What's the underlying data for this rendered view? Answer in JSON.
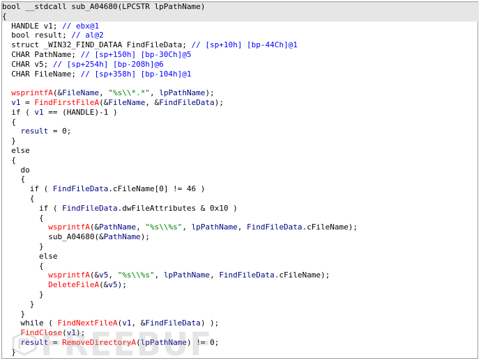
{
  "colors": {
    "keyword": "#000000",
    "comment": "#0000ff",
    "function": "#ff0000",
    "variable": "#000080",
    "string": "#008000",
    "highlight": "#e6e6e6"
  },
  "watermark": {
    "text": "FREEBUF"
  },
  "lines": [
    {
      "hl": true,
      "tokens": [
        {
          "c": "tx",
          "t": "bool __stdcall sub_A04680(LPCSTR lpPathName)"
        }
      ]
    },
    {
      "hl": true,
      "tokens": [
        {
          "c": "tx",
          "t": "{"
        }
      ]
    },
    {
      "tokens": [
        {
          "c": "tx",
          "t": "  HANDLE v1; "
        },
        {
          "c": "cm",
          "t": "// ebx@1"
        }
      ]
    },
    {
      "tokens": [
        {
          "c": "tx",
          "t": "  bool result; "
        },
        {
          "c": "cm",
          "t": "// al@2"
        }
      ]
    },
    {
      "tokens": [
        {
          "c": "tx",
          "t": "  struct _WIN32_FIND_DATAA FindFileData; "
        },
        {
          "c": "cm",
          "t": "// [sp+10h] [bp-44Ch]@1"
        }
      ]
    },
    {
      "tokens": [
        {
          "c": "tx",
          "t": "  CHAR PathName; "
        },
        {
          "c": "cm",
          "t": "// [sp+150h] [bp-30Ch]@5"
        }
      ]
    },
    {
      "tokens": [
        {
          "c": "tx",
          "t": "  CHAR v5; "
        },
        {
          "c": "cm",
          "t": "// [sp+254h] [bp-208h]@6"
        }
      ]
    },
    {
      "tokens": [
        {
          "c": "tx",
          "t": "  CHAR FileName; "
        },
        {
          "c": "cm",
          "t": "// [sp+358h] [bp-104h]@1"
        }
      ]
    },
    {
      "tokens": [
        {
          "c": "tx",
          "t": ""
        }
      ]
    },
    {
      "tokens": [
        {
          "c": "tx",
          "t": "  "
        },
        {
          "c": "fn",
          "t": "wsprintfA"
        },
        {
          "c": "tx",
          "t": "(&"
        },
        {
          "c": "va",
          "t": "FileName"
        },
        {
          "c": "tx",
          "t": ", "
        },
        {
          "c": "st",
          "t": "\"%s\\\\*.*\""
        },
        {
          "c": "tx",
          "t": ", "
        },
        {
          "c": "va",
          "t": "lpPathName"
        },
        {
          "c": "tx",
          "t": ");"
        }
      ]
    },
    {
      "tokens": [
        {
          "c": "tx",
          "t": "  "
        },
        {
          "c": "va",
          "t": "v1"
        },
        {
          "c": "tx",
          "t": " = "
        },
        {
          "c": "fn",
          "t": "FindFirstFileA"
        },
        {
          "c": "tx",
          "t": "(&"
        },
        {
          "c": "va",
          "t": "FileName"
        },
        {
          "c": "tx",
          "t": ", &"
        },
        {
          "c": "va",
          "t": "FindFileData"
        },
        {
          "c": "tx",
          "t": ");"
        }
      ]
    },
    {
      "tokens": [
        {
          "c": "tx",
          "t": "  if ( "
        },
        {
          "c": "va",
          "t": "v1"
        },
        {
          "c": "tx",
          "t": " == (HANDLE)-1 )"
        }
      ]
    },
    {
      "tokens": [
        {
          "c": "tx",
          "t": "  {"
        }
      ]
    },
    {
      "tokens": [
        {
          "c": "tx",
          "t": "    "
        },
        {
          "c": "va",
          "t": "result"
        },
        {
          "c": "tx",
          "t": " = 0;"
        }
      ]
    },
    {
      "tokens": [
        {
          "c": "tx",
          "t": "  }"
        }
      ]
    },
    {
      "tokens": [
        {
          "c": "tx",
          "t": "  else"
        }
      ]
    },
    {
      "tokens": [
        {
          "c": "tx",
          "t": "  {"
        }
      ]
    },
    {
      "tokens": [
        {
          "c": "tx",
          "t": "    do"
        }
      ]
    },
    {
      "tokens": [
        {
          "c": "tx",
          "t": "    {"
        }
      ]
    },
    {
      "tokens": [
        {
          "c": "tx",
          "t": "      if ( "
        },
        {
          "c": "va",
          "t": "FindFileData"
        },
        {
          "c": "tx",
          "t": ".cFileName[0] != 46 )"
        }
      ]
    },
    {
      "tokens": [
        {
          "c": "tx",
          "t": "      {"
        }
      ]
    },
    {
      "tokens": [
        {
          "c": "tx",
          "t": "        if ( "
        },
        {
          "c": "va",
          "t": "FindFileData"
        },
        {
          "c": "tx",
          "t": ".dwFileAttributes & 0x10 )"
        }
      ]
    },
    {
      "tokens": [
        {
          "c": "tx",
          "t": "        {"
        }
      ]
    },
    {
      "tokens": [
        {
          "c": "tx",
          "t": "          "
        },
        {
          "c": "fn",
          "t": "wsprintfA"
        },
        {
          "c": "tx",
          "t": "(&"
        },
        {
          "c": "va",
          "t": "PathName"
        },
        {
          "c": "tx",
          "t": ", "
        },
        {
          "c": "st",
          "t": "\"%s\\\\%s\""
        },
        {
          "c": "tx",
          "t": ", "
        },
        {
          "c": "va",
          "t": "lpPathName"
        },
        {
          "c": "tx",
          "t": ", "
        },
        {
          "c": "va",
          "t": "FindFileData"
        },
        {
          "c": "tx",
          "t": ".cFileName);"
        }
      ]
    },
    {
      "tokens": [
        {
          "c": "tx",
          "t": "          sub_A04680(&"
        },
        {
          "c": "va",
          "t": "PathName"
        },
        {
          "c": "tx",
          "t": ");"
        }
      ]
    },
    {
      "tokens": [
        {
          "c": "tx",
          "t": "        }"
        }
      ]
    },
    {
      "tokens": [
        {
          "c": "tx",
          "t": "        else"
        }
      ]
    },
    {
      "tokens": [
        {
          "c": "tx",
          "t": "        {"
        }
      ]
    },
    {
      "tokens": [
        {
          "c": "tx",
          "t": "          "
        },
        {
          "c": "fn",
          "t": "wsprintfA"
        },
        {
          "c": "tx",
          "t": "(&"
        },
        {
          "c": "va",
          "t": "v5"
        },
        {
          "c": "tx",
          "t": ", "
        },
        {
          "c": "st",
          "t": "\"%s\\\\%s\""
        },
        {
          "c": "tx",
          "t": ", "
        },
        {
          "c": "va",
          "t": "lpPathName"
        },
        {
          "c": "tx",
          "t": ", "
        },
        {
          "c": "va",
          "t": "FindFileData"
        },
        {
          "c": "tx",
          "t": ".cFileName);"
        }
      ]
    },
    {
      "tokens": [
        {
          "c": "tx",
          "t": "          "
        },
        {
          "c": "fn",
          "t": "DeleteFileA"
        },
        {
          "c": "tx",
          "t": "(&"
        },
        {
          "c": "va",
          "t": "v5"
        },
        {
          "c": "tx",
          "t": ");"
        }
      ]
    },
    {
      "tokens": [
        {
          "c": "tx",
          "t": "        }"
        }
      ]
    },
    {
      "tokens": [
        {
          "c": "tx",
          "t": "      }"
        }
      ]
    },
    {
      "tokens": [
        {
          "c": "tx",
          "t": "    }"
        }
      ]
    },
    {
      "tokens": [
        {
          "c": "tx",
          "t": "    while ( "
        },
        {
          "c": "fn",
          "t": "FindNextFileA"
        },
        {
          "c": "tx",
          "t": "("
        },
        {
          "c": "va",
          "t": "v1"
        },
        {
          "c": "tx",
          "t": ", &"
        },
        {
          "c": "va",
          "t": "FindFileData"
        },
        {
          "c": "tx",
          "t": ") );"
        }
      ]
    },
    {
      "tokens": [
        {
          "c": "tx",
          "t": "    "
        },
        {
          "c": "fn",
          "t": "FindClose"
        },
        {
          "c": "tx",
          "t": "("
        },
        {
          "c": "va",
          "t": "v1"
        },
        {
          "c": "tx",
          "t": ");"
        }
      ]
    },
    {
      "tokens": [
        {
          "c": "tx",
          "t": "    "
        },
        {
          "c": "va",
          "t": "result"
        },
        {
          "c": "tx",
          "t": " = "
        },
        {
          "c": "fn",
          "t": "RemoveDirectoryA"
        },
        {
          "c": "tx",
          "t": "("
        },
        {
          "c": "va",
          "t": "lpPathName"
        },
        {
          "c": "tx",
          "t": ") != 0;"
        }
      ]
    },
    {
      "tokens": [
        {
          "c": "tx",
          "t": "  }"
        }
      ]
    }
  ]
}
